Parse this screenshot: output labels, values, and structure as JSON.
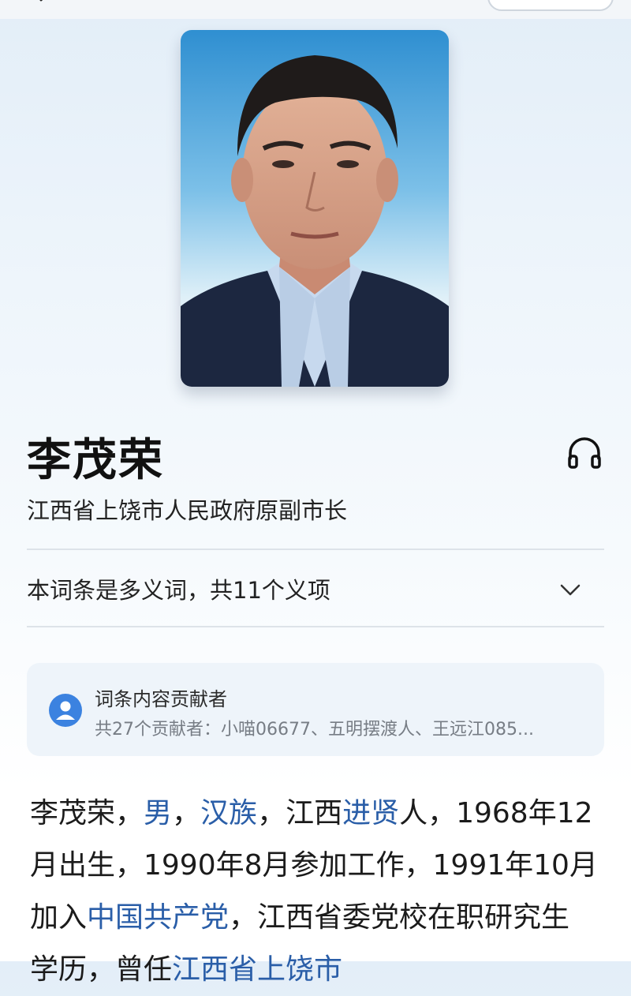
{
  "person": {
    "name": "李茂荣",
    "description": "江西省上饶市人民政府原副市长"
  },
  "polysemy": {
    "text": "本词条是多义词，共11个义项"
  },
  "contributors": {
    "title": "词条内容贡献者",
    "summary": "共27个贡献者：小喵06677、五明摆渡人、王远江085..."
  },
  "article": {
    "segments": [
      {
        "text": "李茂荣，",
        "link": false
      },
      {
        "text": "男",
        "link": true
      },
      {
        "text": "，",
        "link": false
      },
      {
        "text": "汉族",
        "link": true
      },
      {
        "text": "，江西",
        "link": false
      },
      {
        "text": "进贤",
        "link": true
      },
      {
        "text": "人，1968年12月出生，1990年8月参加工作，1991年10月加入",
        "link": false
      },
      {
        "text": "中国共产党",
        "link": true
      },
      {
        "text": "，江西省委党校在职研究生学历，曾任",
        "link": false
      },
      {
        "text": "江西省上饶市",
        "link": true
      }
    ]
  },
  "icons": {
    "audio": "headphones-icon",
    "expand": "chevron-down-icon",
    "contributor": "user-avatar-icon"
  },
  "colors": {
    "link": "#2a5ea8",
    "avatar": "#3b82e0"
  }
}
